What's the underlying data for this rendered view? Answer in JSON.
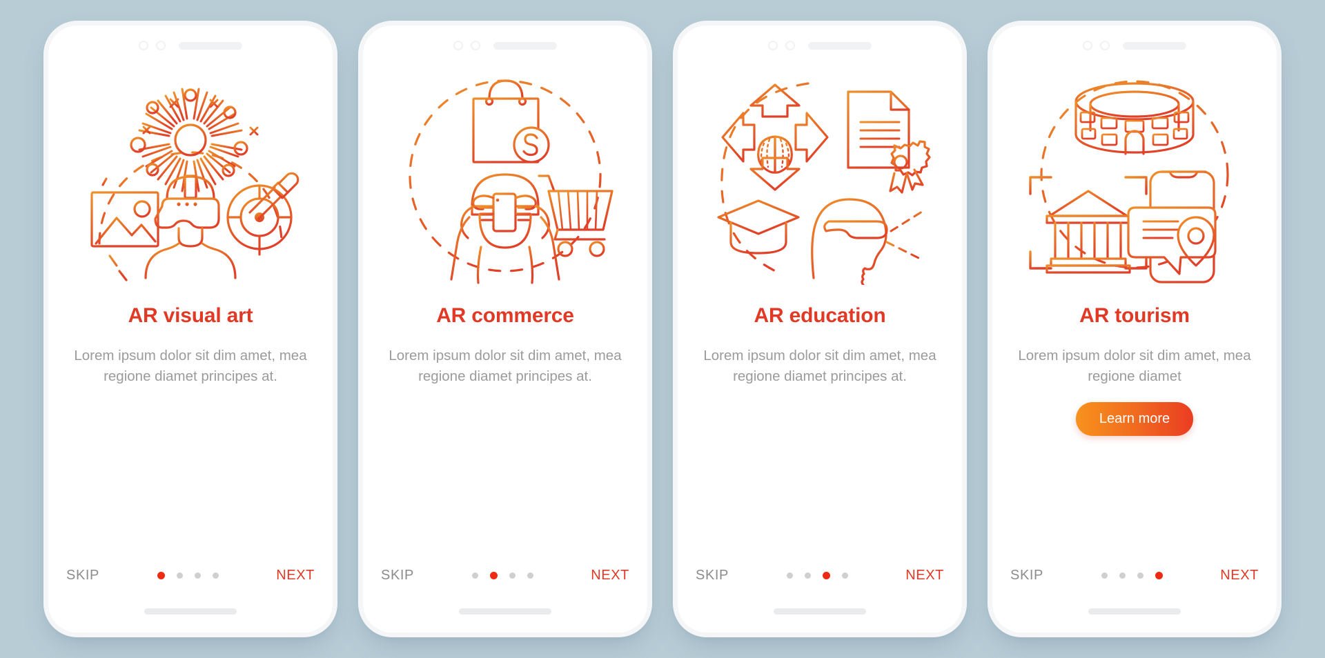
{
  "background_color": "#b8ccd6",
  "theme": {
    "accent_red": "#e03a26",
    "accent_orange": "#f7921e",
    "dot_active": "#ef2a13",
    "dot_inactive": "#cfcfcf",
    "body_text": "#9b9b9b",
    "skip_text": "#8d8d8d"
  },
  "screens": [
    {
      "title": "AR visual art",
      "body": "Lorem ipsum dolor sit dim amet, mea regione diamet principes at.",
      "skip_label": "SKIP",
      "next_label": "NEXT",
      "active_dot": 0,
      "dot_count": 4,
      "cta_label": null,
      "illustration_name": "ar-visual-art-illustration"
    },
    {
      "title": "AR commerce",
      "body": "Lorem ipsum dolor sit dim amet, mea regione diamet principes at.",
      "skip_label": "SKIP",
      "next_label": "NEXT",
      "active_dot": 1,
      "dot_count": 4,
      "cta_label": null,
      "illustration_name": "ar-commerce-illustration"
    },
    {
      "title": "AR education",
      "body": "Lorem ipsum dolor sit dim amet, mea regione diamet principes at.",
      "skip_label": "SKIP",
      "next_label": "NEXT",
      "active_dot": 2,
      "dot_count": 4,
      "cta_label": null,
      "illustration_name": "ar-education-illustration"
    },
    {
      "title": "AR tourism",
      "body": "Lorem ipsum dolor sit dim amet, mea regione diamet",
      "skip_label": "SKIP",
      "next_label": "NEXT",
      "active_dot": 3,
      "dot_count": 4,
      "cta_label": "Learn more",
      "illustration_name": "ar-tourism-illustration"
    }
  ]
}
